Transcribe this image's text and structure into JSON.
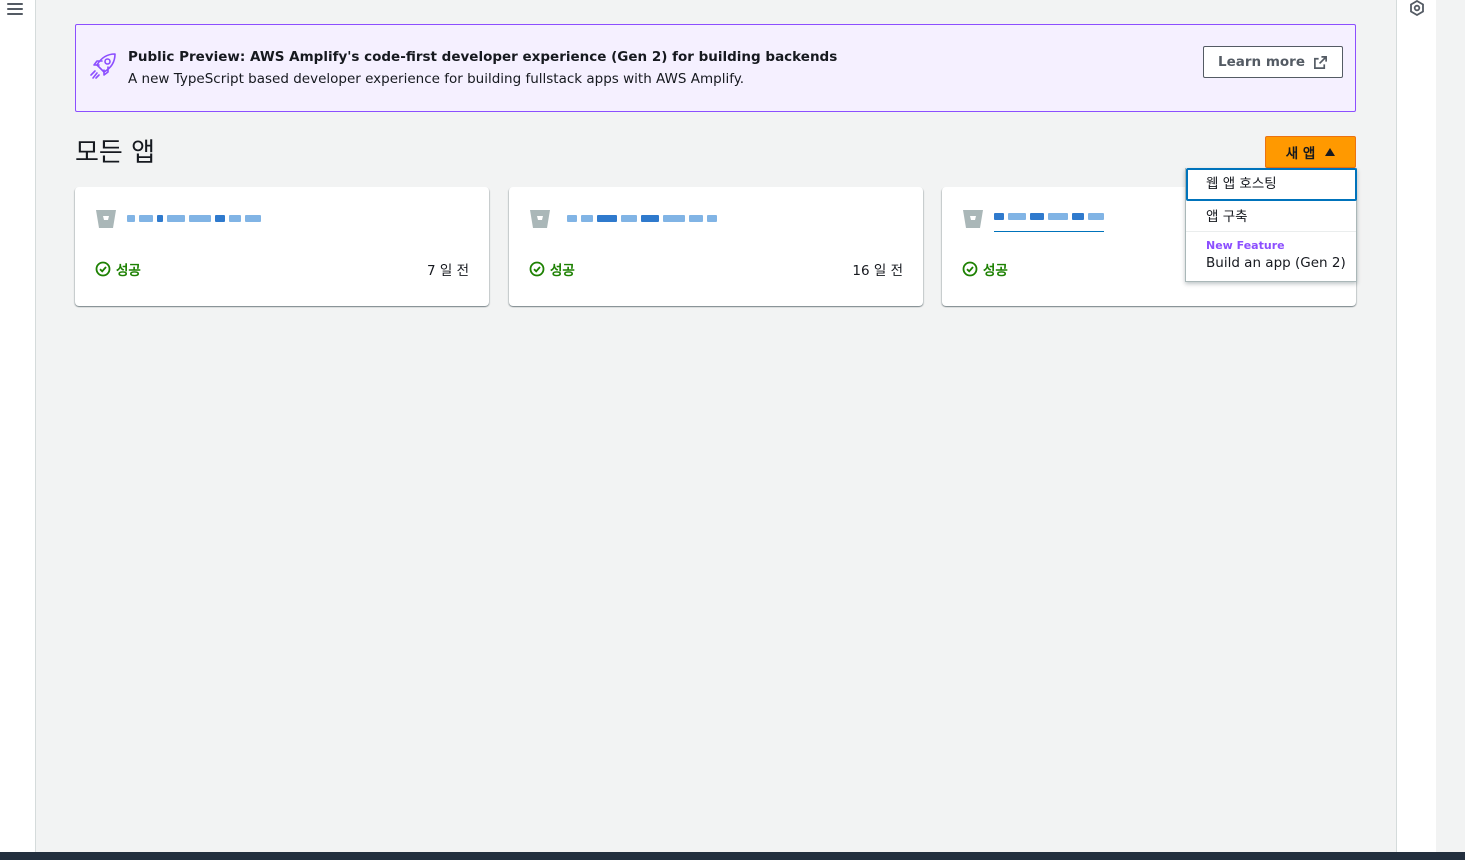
{
  "banner": {
    "title": "Public Preview: AWS Amplify's code-first developer experience (Gen 2) for building backends",
    "description": "A new TypeScript based developer experience for building fullstack apps with AWS Amplify.",
    "learn_more_label": "Learn more",
    "accent_color": "#8c4fff",
    "background_color": "#f5f0ff",
    "icon": "rocket-icon"
  },
  "page": {
    "title": "모든 앱"
  },
  "new_app_button": {
    "label": "새 앱",
    "color": "#ff9900"
  },
  "new_app_menu": {
    "items": [
      {
        "label": "웹 앱 호스팅"
      },
      {
        "label": "앱 구축"
      },
      {
        "tag": "New Feature",
        "label": "Build an app (Gen 2)"
      }
    ]
  },
  "apps": [
    {
      "status": "성공",
      "updated": "7 일 전",
      "name_obscured": true
    },
    {
      "status": "성공",
      "updated": "16 일 전",
      "name_obscured": true
    },
    {
      "status": "성공",
      "updated": "",
      "name_obscured": true
    }
  ],
  "colors": {
    "status_success": "#1d8102",
    "link": "#0073bb",
    "top_nav": "#232f3e"
  }
}
